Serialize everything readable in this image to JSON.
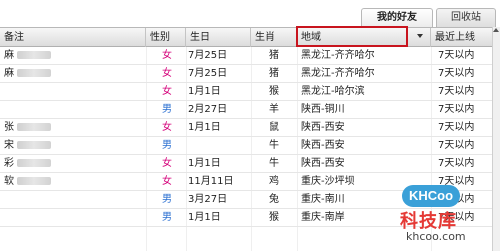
{
  "tabs": [
    {
      "label": "我的好友",
      "active": true
    },
    {
      "label": "回收站",
      "active": false
    }
  ],
  "columns": [
    "备注",
    "性别",
    "生日",
    "生肖",
    "地域",
    "最近上线"
  ],
  "rows": [
    {
      "note": "麻",
      "gender": "女",
      "birthday": "7月25日",
      "zodiac": "猪",
      "region": "黑龙江-齐齐哈尔",
      "last_login": "7天以内"
    },
    {
      "note": "麻",
      "gender": "女",
      "birthday": "7月25日",
      "zodiac": "猪",
      "region": "黑龙江-齐齐哈尔",
      "last_login": "7天以内"
    },
    {
      "note": "",
      "gender": "女",
      "birthday": "1月1日",
      "zodiac": "猴",
      "region": "黑龙江-哈尔滨",
      "last_login": "7天以内"
    },
    {
      "note": "",
      "gender": "男",
      "birthday": "2月27日",
      "zodiac": "羊",
      "region": "陕西-铜川",
      "last_login": "7天以内"
    },
    {
      "note": "张",
      "gender": "女",
      "birthday": "1月1日",
      "zodiac": "鼠",
      "region": "陕西-西安",
      "last_login": "7天以内"
    },
    {
      "note": "宋",
      "gender": "男",
      "birthday": "",
      "zodiac": "牛",
      "region": "陕西-西安",
      "last_login": "7天以内"
    },
    {
      "note": "彩",
      "gender": "女",
      "birthday": "1月1日",
      "zodiac": "牛",
      "region": "陕西-西安",
      "last_login": "7天以内"
    },
    {
      "note": "软",
      "gender": "女",
      "birthday": "11月11日",
      "zodiac": "鸡",
      "region": "重庆-沙坪坝",
      "last_login": "7天以内"
    },
    {
      "note": "",
      "gender": "男",
      "birthday": "3月27日",
      "zodiac": "兔",
      "region": "重庆-南川",
      "last_login": "7天以内"
    },
    {
      "note": "",
      "gender": "男",
      "birthday": "1月1日",
      "zodiac": "猴",
      "region": "重庆-南岸",
      "last_login": "7天以内"
    }
  ],
  "watermark": {
    "logo": "KHCoo",
    "name": "科技库",
    "url": "khcoo.com"
  },
  "colors": {
    "female": "#d4007a",
    "male": "#2a6fd1",
    "highlight": "#c8141e"
  }
}
